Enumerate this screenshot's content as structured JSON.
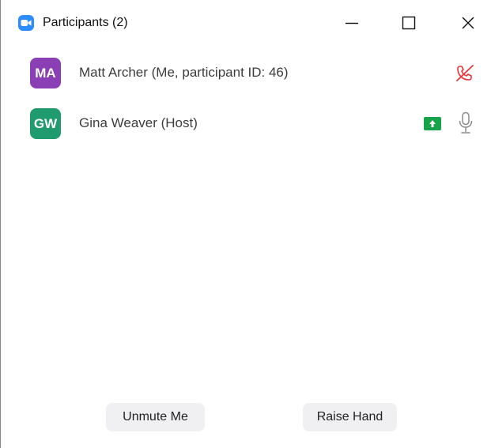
{
  "window": {
    "title": "Participants (2)",
    "controls": {
      "minimize": "minimize-icon",
      "maximize": "maximize-icon",
      "close": "close-icon"
    },
    "app_icon": "video-camera-icon",
    "accent_color": "#2d8cff"
  },
  "participants": [
    {
      "initials": "MA",
      "avatar_color": "#8b3fb5",
      "name": "Matt Archer (Me, participant ID: 46)",
      "status_icons": [
        "audio-disconnected-icon"
      ],
      "status_color": "#e8363b"
    },
    {
      "initials": "GW",
      "avatar_color": "#1f9b6f",
      "name": "Gina Weaver (Host)",
      "status_icons": [
        "screen-share-icon",
        "microphone-icon"
      ],
      "share_color": "#16a34a"
    }
  ],
  "actions": {
    "unmute_label": "Unmute Me",
    "raise_hand_label": "Raise Hand"
  }
}
